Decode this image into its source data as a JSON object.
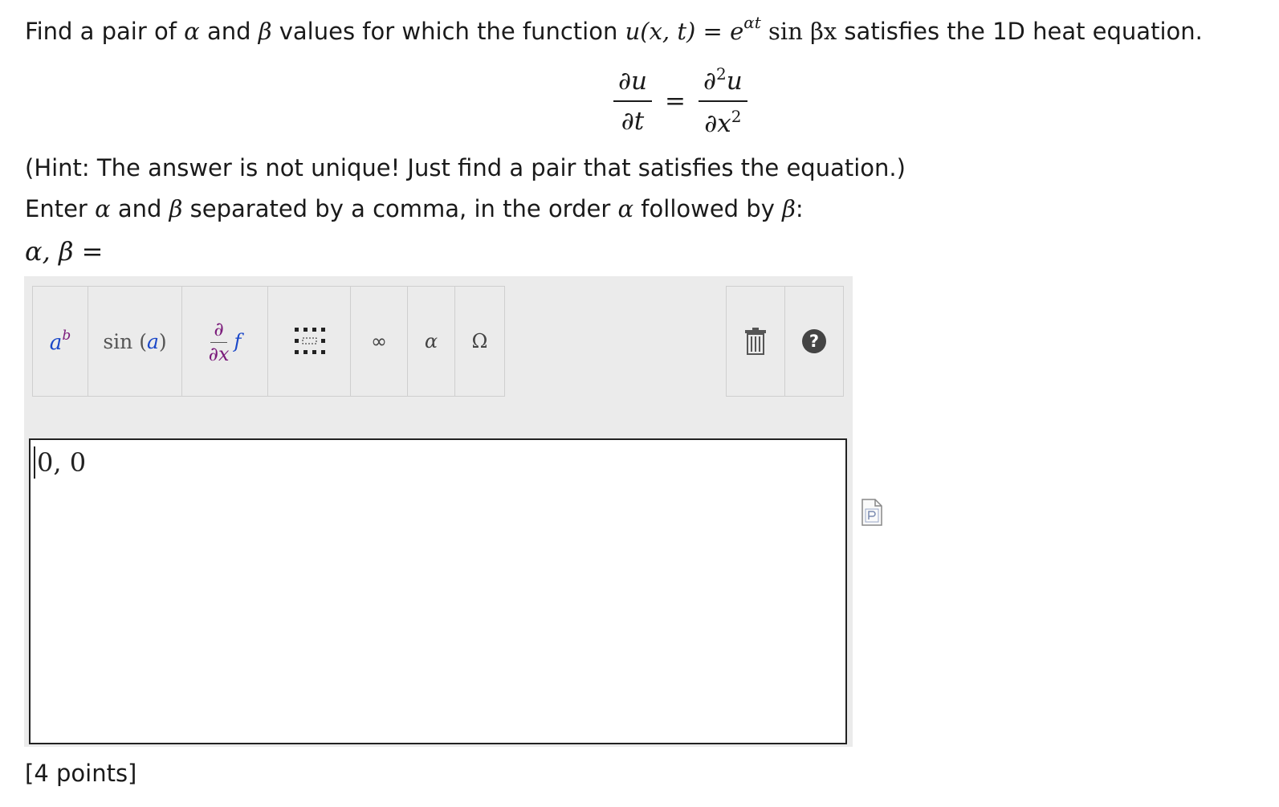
{
  "question": {
    "intro": "Find a pair of ",
    "and": " and ",
    "values_text": " values for which the function ",
    "func_lhs": "u(x, t)",
    "equals": " = ",
    "exp_base": "e",
    "exp_power": "αt",
    "func_rhs": " sin βx",
    "tail": " satisfies the 1D heat equation.",
    "alpha": "α",
    "beta": "β"
  },
  "equation": {
    "lhs_num": "∂u",
    "lhs_den": "∂t",
    "eq": "=",
    "rhs_num_base": "∂",
    "rhs_num_sup": "2",
    "rhs_num_var": "u",
    "rhs_den_base": "∂x",
    "rhs_den_sup": "2"
  },
  "hint": "(Hint: The answer is not unique! Just find a pair that satisfies the equation.)",
  "instruction": {
    "p1": "Enter ",
    "alpha": "α",
    "p2": " and ",
    "beta": "β",
    "p3": " separated by a comma, in the order ",
    "alpha2": "α",
    "p4": " followed by ",
    "beta2": "β",
    "p5": ":"
  },
  "answer_label": "α, β =",
  "toolbar": {
    "superscript": {
      "base": "a",
      "sup": "b",
      "icon": "superscript-icon"
    },
    "function": {
      "name": "sin",
      "arg": "a",
      "icon": "function-icon"
    },
    "derivative": {
      "num": "∂",
      "den": "∂x",
      "f": "f",
      "icon": "derivative-icon"
    },
    "matrix": {
      "icon": "matrix-icon"
    },
    "infinity": {
      "label": "∞",
      "icon": "infinity-icon"
    },
    "greek": {
      "label": "α",
      "icon": "greek-alpha-icon"
    },
    "symbols": {
      "label": "Ω",
      "icon": "omega-icon"
    },
    "trash": {
      "icon": "trash-icon"
    },
    "help": {
      "label": "?",
      "icon": "help-icon"
    }
  },
  "answer_value": "0, 0",
  "points": "[4 points]"
}
